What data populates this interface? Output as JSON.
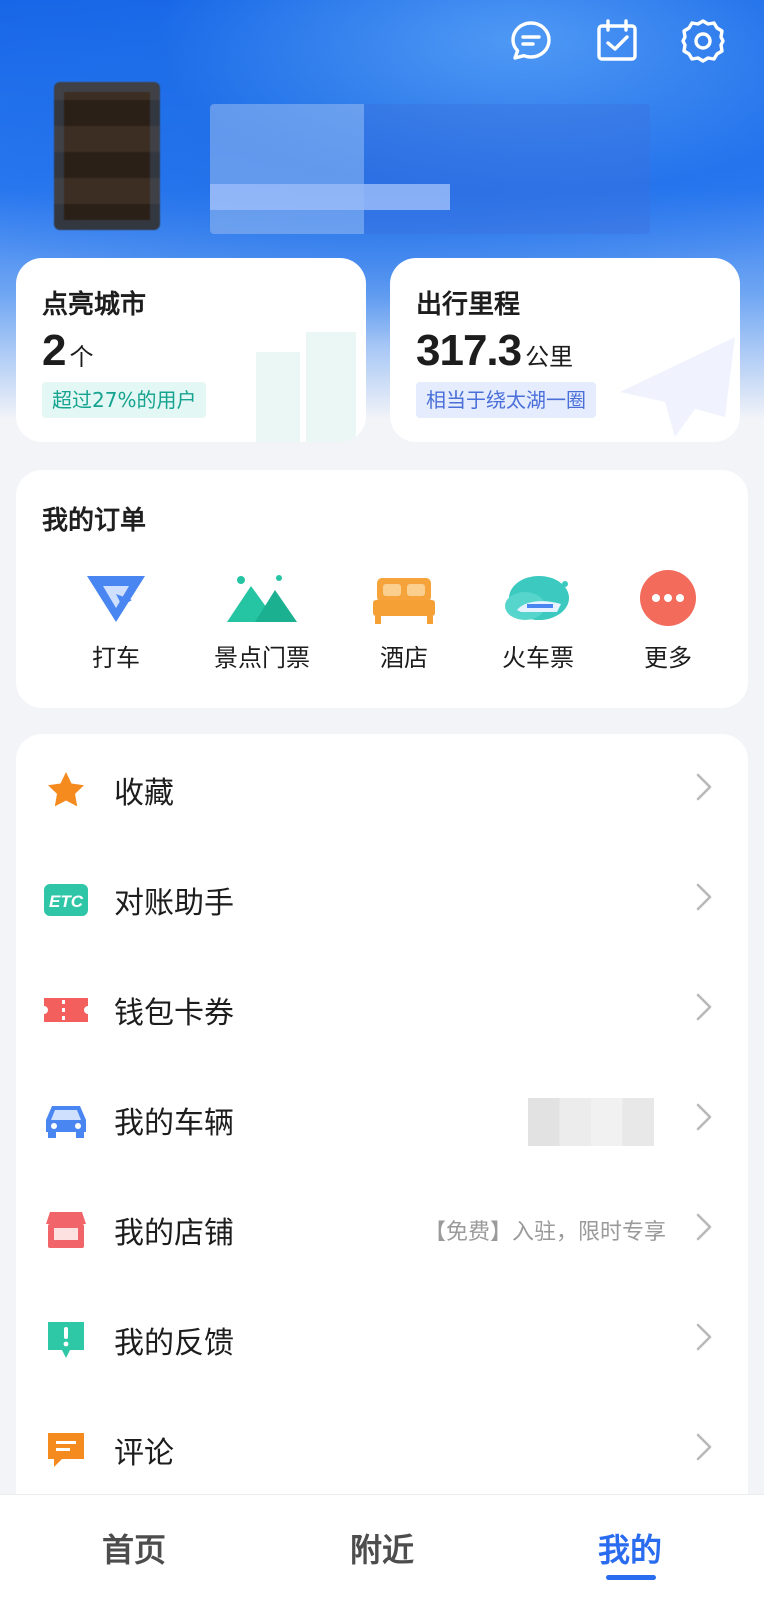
{
  "header": {
    "icons": [
      "message-icon",
      "calendar-check-icon",
      "settings-icon"
    ]
  },
  "stats": {
    "cities": {
      "title": "点亮城市",
      "value": "2",
      "unit": "个",
      "note": "超过27%的用户"
    },
    "mileage": {
      "title": "出行里程",
      "value": "317.3",
      "unit": "公里",
      "note": "相当于绕太湖一圈"
    }
  },
  "orders": {
    "title": "我的订单",
    "items": [
      {
        "label": "打车",
        "icon": "taxi-icon"
      },
      {
        "label": "景点门票",
        "icon": "mountain-icon"
      },
      {
        "label": "酒店",
        "icon": "bed-icon"
      },
      {
        "label": "火车票",
        "icon": "train-cloud-icon"
      },
      {
        "label": "更多",
        "icon": "more-dots-icon"
      }
    ]
  },
  "menu": {
    "items": [
      {
        "label": "收藏",
        "icon": "star-icon",
        "hint": ""
      },
      {
        "label": "对账助手",
        "icon": "etc-icon",
        "hint": ""
      },
      {
        "label": "钱包卡券",
        "icon": "ticket-icon",
        "hint": ""
      },
      {
        "label": "我的车辆",
        "icon": "car-icon",
        "hint": ""
      },
      {
        "label": "我的店铺",
        "icon": "store-icon",
        "hint": "【免费】入驻，限时专享"
      },
      {
        "label": "我的反馈",
        "icon": "feedback-icon",
        "hint": ""
      },
      {
        "label": "评论",
        "icon": "comment-icon",
        "hint": ""
      }
    ]
  },
  "tabbar": {
    "tabs": [
      "首页",
      "附近",
      "我的"
    ],
    "active": "我的"
  },
  "colors": {
    "accent": "#2a6cf0",
    "star": "#f58a1f",
    "etc": "#2fc6a8",
    "ticket": "#f25f5c",
    "car": "#4a86f2",
    "store": "#f0646a",
    "feedback": "#2ec8a6",
    "comment": "#f58a1f"
  }
}
